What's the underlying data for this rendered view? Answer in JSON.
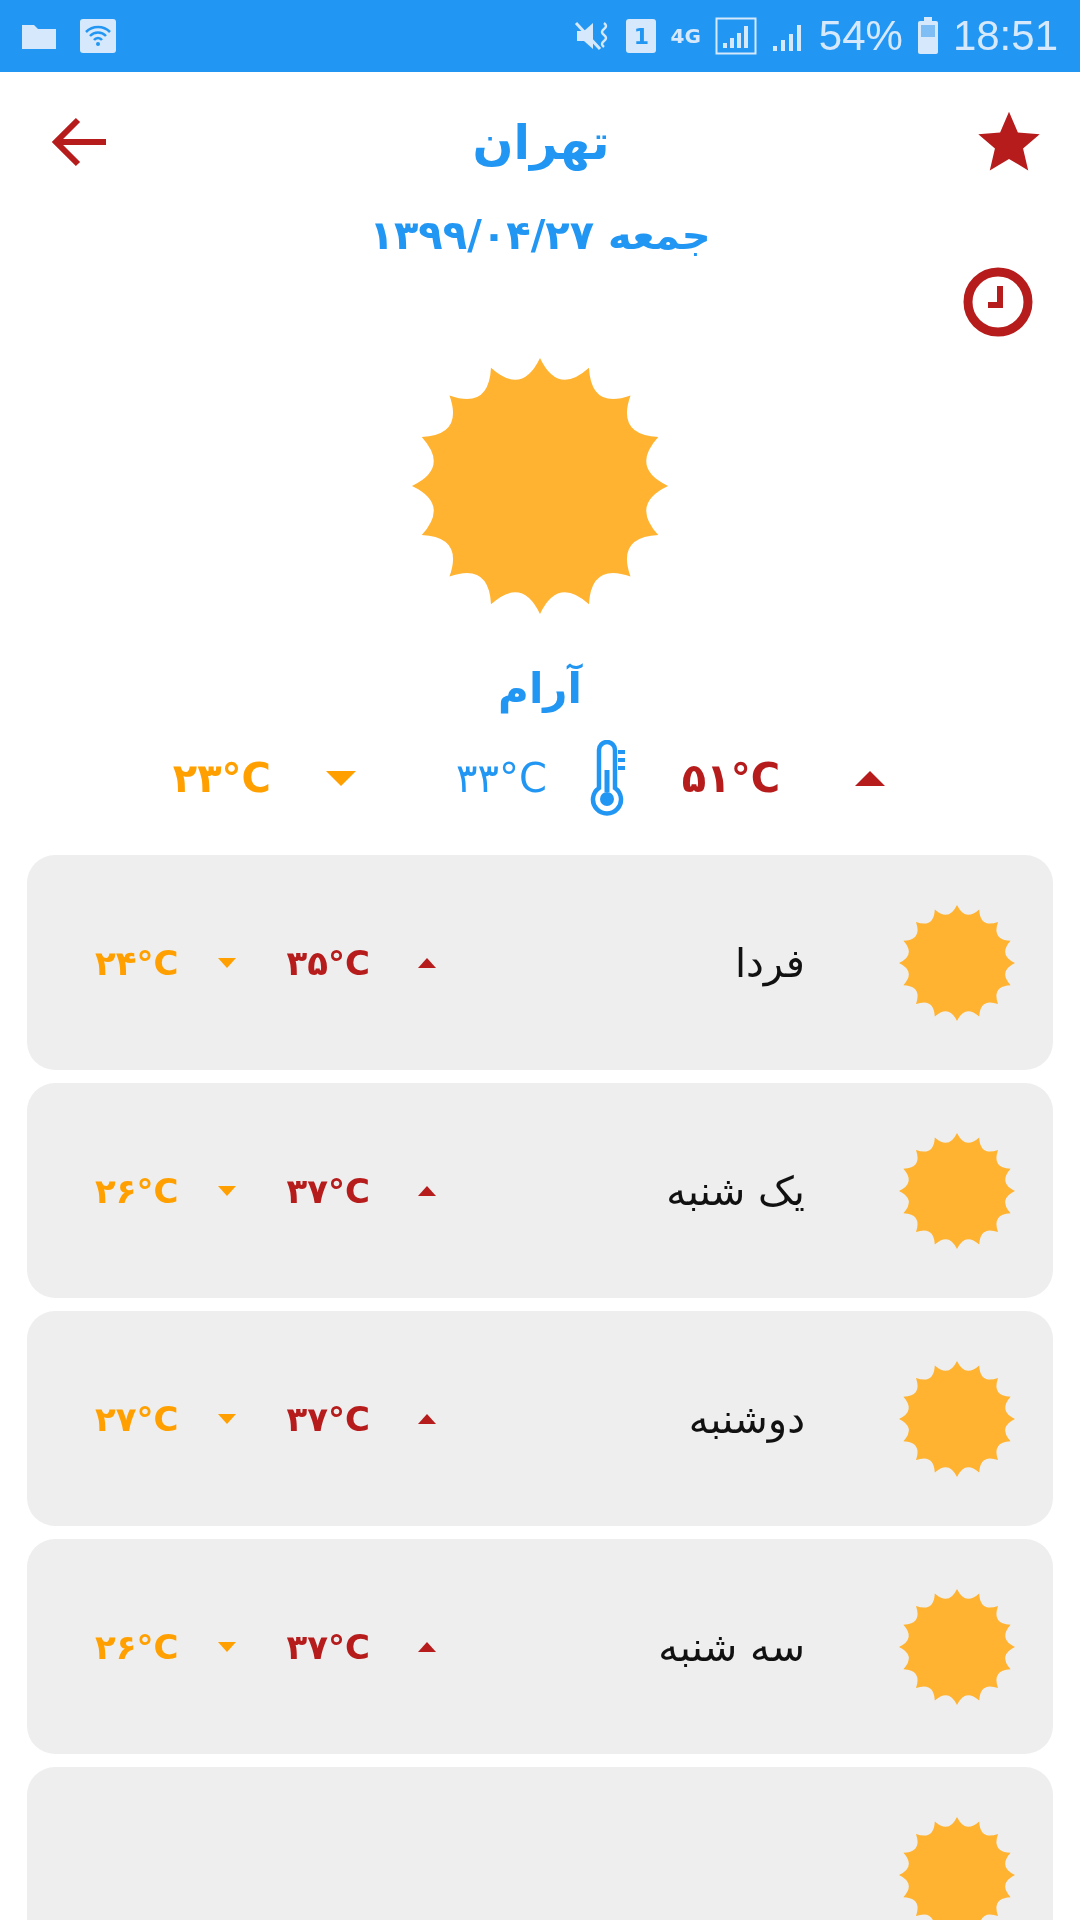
{
  "status_bar": {
    "sim": "1",
    "network": "4G",
    "battery": "54%",
    "time": "18:51"
  },
  "header": {
    "city": "تهران",
    "date": "جمعه ۱۳۹۹/۰۴/۲۷"
  },
  "current": {
    "condition": "آرام",
    "max": "۵۱°C",
    "now": "۳۳°C",
    "min": "۲۳°C"
  },
  "days": [
    {
      "kind": "day",
      "name": "فردا",
      "max": "۳۵°C",
      "min": "۲۴°C"
    },
    {
      "kind": "day",
      "name": "یک شنبه",
      "max": "۳۷°C",
      "min": "۲۶°C"
    },
    {
      "kind": "day",
      "name": "دوشنبه",
      "max": "۳۷°C",
      "min": "۲۷°C"
    },
    {
      "kind": "day",
      "name": "سه شنبه",
      "max": "۳۷°C",
      "min": "۲۶°C"
    },
    {
      "kind": "partial"
    }
  ]
}
